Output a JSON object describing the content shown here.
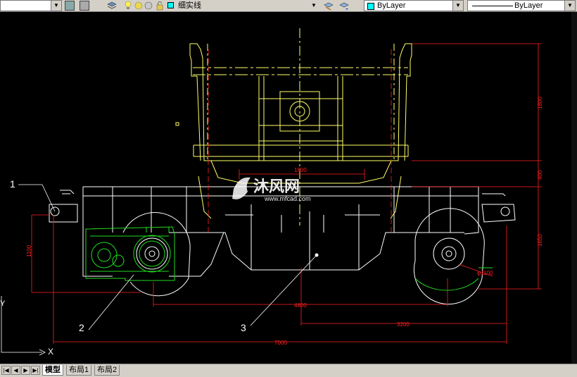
{
  "toolbar": {
    "layer_name": "细实线",
    "color_value": "ByLayer",
    "linetype_value": "ByLayer",
    "colors": {
      "layer_swatch": "#00ffff",
      "color_swatch": "#00ffff"
    }
  },
  "drawing": {
    "labels": {
      "part1": "1",
      "part2": "2",
      "part3": "3"
    },
    "dimensions": {
      "total_length": "7000",
      "wheelbase": "4800",
      "half_track": "3200",
      "top_width": "1800",
      "height_upper": "1800",
      "height_mid": "400",
      "height_lower": "1650",
      "left_height": "1100",
      "wheel_dia": "φ1100"
    },
    "axis": {
      "x_label": "X",
      "y_label": "Y"
    },
    "watermark": {
      "name": "沐风网",
      "url": "www.mfcad.com"
    },
    "colors": {
      "yellow": "#ffff66",
      "red": "#ff2020",
      "green": "#22dd22",
      "white": "#ffffff"
    }
  },
  "status": {
    "tabs": [
      {
        "label": "模型",
        "active": true
      },
      {
        "label": "布局1",
        "active": false
      },
      {
        "label": "布局2",
        "active": false
      }
    ]
  }
}
